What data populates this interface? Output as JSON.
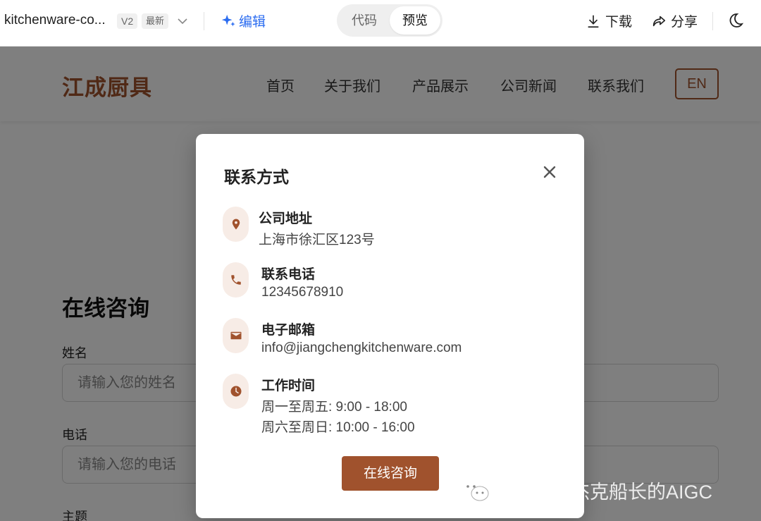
{
  "toolbar": {
    "project_name": "kitchenware-co...",
    "version": "V2",
    "latest": "最新",
    "edit_label": "编辑",
    "view_modes": [
      {
        "label": "代码",
        "active": false
      },
      {
        "label": "预览",
        "active": true
      }
    ],
    "download_label": "下载",
    "share_label": "分享"
  },
  "site": {
    "brand": "江成厨具",
    "nav": [
      "首页",
      "关于我们",
      "产品展示",
      "公司新闻",
      "联系我们"
    ],
    "lang_button": "EN",
    "accent_color": "#a0522d"
  },
  "form": {
    "title": "在线咨询",
    "fields": [
      {
        "label": "姓名",
        "placeholder": "请输入您的姓名"
      },
      {
        "label": "电话",
        "placeholder": "请输入您的电话"
      },
      {
        "label": "主题",
        "placeholder": ""
      }
    ]
  },
  "modal": {
    "title": "联系方式",
    "items": [
      {
        "icon": "map-pin-icon",
        "label": "公司地址",
        "values": [
          "上海市徐汇区123号"
        ]
      },
      {
        "icon": "phone-icon",
        "label": "联系电话",
        "values": [
          "12345678910"
        ]
      },
      {
        "icon": "envelope-icon",
        "label": "电子邮箱",
        "values": [
          "info@jiangchengkitchenware.com"
        ]
      },
      {
        "icon": "clock-icon",
        "label": "工作时间",
        "values": [
          "周一至周五: 9:00 - 18:00",
          "周六至周日: 10:00 - 16:00"
        ]
      }
    ],
    "cta_label": "在线咨询"
  },
  "watermark": {
    "text": "公众号 · 杰克船长的AIGC",
    "icon": "wechat-icon"
  }
}
